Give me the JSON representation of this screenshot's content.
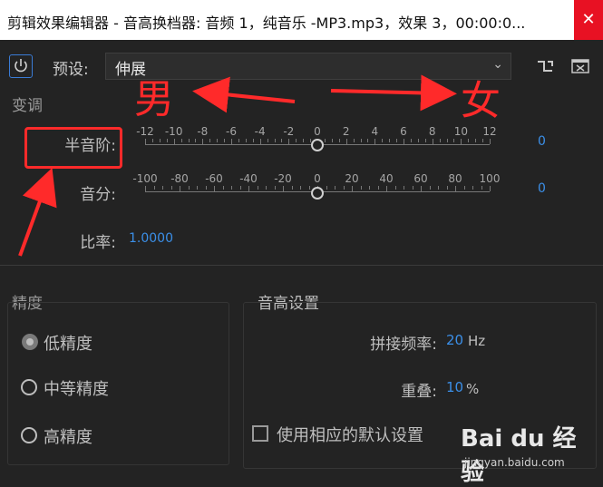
{
  "window": {
    "title": "剪辑效果编辑器 - 音高换档器: 音频 1，纯音乐 -MP3.mp3，效果 3，00:00:0...",
    "close_glyph": "✕"
  },
  "toolbar": {
    "power_icon": "power-icon",
    "preset_label": "预设:",
    "preset_value": "伸展",
    "chevron_glyph": "⌄",
    "icons": [
      "routing-icon",
      "fullscreen-icon"
    ]
  },
  "transpose": {
    "section_label": "变调",
    "semitones": {
      "label": "半音阶:",
      "ticks": [
        "-12",
        "-10",
        "-8",
        "-6",
        "-4",
        "-2",
        "0",
        "2",
        "4",
        "6",
        "8",
        "10",
        "12"
      ],
      "min": -12,
      "max": 12,
      "value": 0,
      "value_text": "0"
    },
    "cents": {
      "label": "音分:",
      "ticks": [
        "-100",
        "-80",
        "-60",
        "-40",
        "-20",
        "0",
        "20",
        "40",
        "60",
        "80",
        "100"
      ],
      "min": -100,
      "max": 100,
      "value": 0,
      "value_text": "0"
    },
    "ratio": {
      "label": "比率:",
      "value": "1.0000"
    }
  },
  "precision": {
    "section_label": "精度",
    "options": [
      {
        "label": "低精度",
        "selected": true
      },
      {
        "label": "中等精度",
        "selected": false
      },
      {
        "label": "高精度",
        "selected": false
      }
    ]
  },
  "pitch_settings": {
    "section_label": "音高设置",
    "splice_freq": {
      "label": "拼接频率:",
      "value": "20",
      "unit": "Hz"
    },
    "overlap": {
      "label": "重叠:",
      "value": "10",
      "unit": "%"
    },
    "use_defaults": {
      "label": "使用相应的默认设置",
      "checked": false
    }
  },
  "annotations": {
    "male": "男",
    "female": "女",
    "color": "#ff2a2a"
  },
  "watermark": {
    "brand": "Bai du 经验",
    "url": "jingyan.baidu.com"
  }
}
